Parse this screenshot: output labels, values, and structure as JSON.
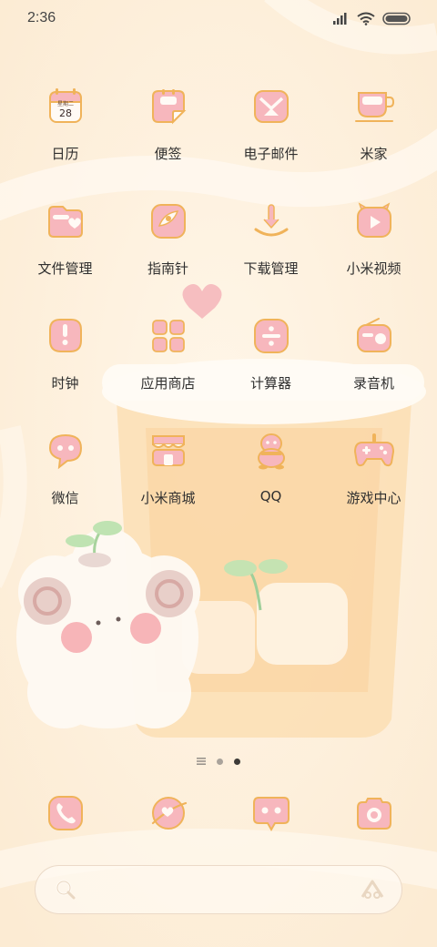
{
  "status_bar": {
    "time": "2:36"
  },
  "calendar_icon": {
    "weekday": "星期二",
    "day": "28"
  },
  "apps": [
    [
      {
        "label": "日历",
        "icon": "calendar-icon"
      },
      {
        "label": "便签",
        "icon": "notes-icon"
      },
      {
        "label": "电子邮件",
        "icon": "email-icon"
      },
      {
        "label": "米家",
        "icon": "mijia-icon"
      }
    ],
    [
      {
        "label": "文件管理",
        "icon": "folder-icon"
      },
      {
        "label": "指南针",
        "icon": "compass-icon"
      },
      {
        "label": "下载管理",
        "icon": "download-icon"
      },
      {
        "label": "小米视频",
        "icon": "video-icon"
      }
    ],
    [
      {
        "label": "时钟",
        "icon": "clock-icon"
      },
      {
        "label": "应用商店",
        "icon": "app-store-icon"
      },
      {
        "label": "计算器",
        "icon": "calculator-icon"
      },
      {
        "label": "录音机",
        "icon": "recorder-icon"
      }
    ],
    [
      {
        "label": "微信",
        "icon": "wechat-icon"
      },
      {
        "label": "小米商城",
        "icon": "mi-store-icon"
      },
      {
        "label": "QQ",
        "icon": "qq-icon"
      },
      {
        "label": "游戏中心",
        "icon": "game-center-icon"
      }
    ]
  ],
  "dock": [
    {
      "icon": "phone-icon"
    },
    {
      "icon": "browser-icon"
    },
    {
      "icon": "messages-icon"
    },
    {
      "icon": "camera-icon"
    }
  ],
  "pager": {
    "pages": 3,
    "current": 3
  },
  "colors": {
    "background": "#fdf0de",
    "icon_fill": "#f7b7bd",
    "icon_outline": "#f0b35a",
    "icon_white": "#fffaf5"
  }
}
